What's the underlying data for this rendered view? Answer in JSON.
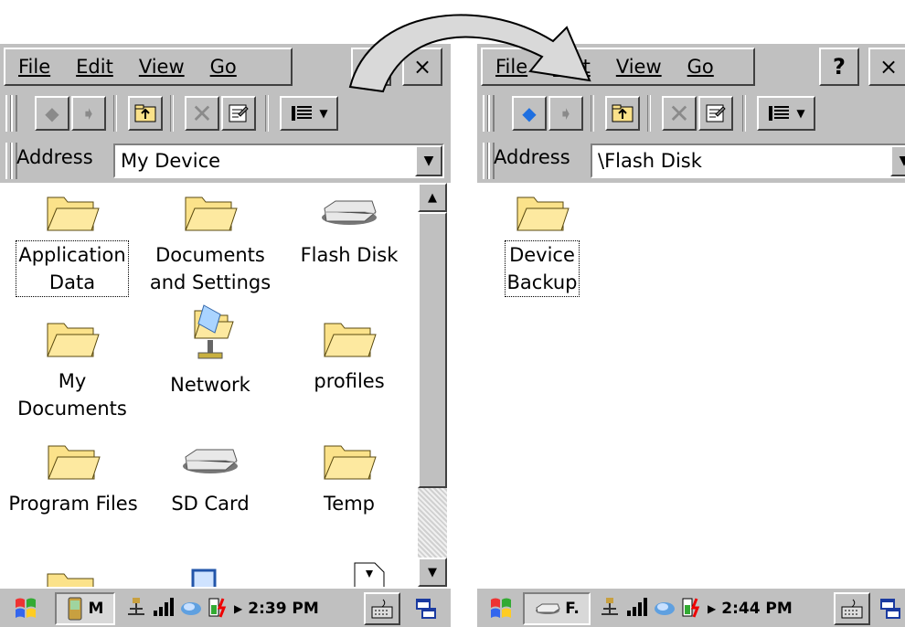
{
  "menu": {
    "items": [
      "File",
      "Edit",
      "View",
      "Go"
    ]
  },
  "left_window": {
    "address_label": "Address",
    "address_value": "My Device",
    "items": [
      {
        "label": "Application\nData",
        "icon": "folder-icon"
      },
      {
        "label": "Documents\nand Settings",
        "icon": "folder-icon"
      },
      {
        "label": "Flash Disk",
        "icon": "drive-icon"
      },
      {
        "label": "My\nDocuments",
        "icon": "folder-icon"
      },
      {
        "label": "Network",
        "icon": "network-icon"
      },
      {
        "label": "profiles",
        "icon": "folder-icon"
      },
      {
        "label": "Program Files",
        "icon": "folder-icon"
      },
      {
        "label": "SD Card",
        "icon": "drive-icon"
      },
      {
        "label": "Temp",
        "icon": "folder-icon"
      }
    ],
    "taskbar_task": "M",
    "clock": "2:39 PM"
  },
  "right_window": {
    "address_label": "Address",
    "address_value": "\\Flash Disk",
    "items": [
      {
        "label": "Device\nBackup",
        "icon": "folder-icon"
      }
    ],
    "taskbar_task": "F.",
    "clock": "2:44 PM"
  },
  "buttons": {
    "close": "×",
    "help": "?"
  },
  "colors": {
    "chrome": "#c0c0c0",
    "folder": "#fbe28a",
    "arrow_fill": "#d9d9d9"
  }
}
